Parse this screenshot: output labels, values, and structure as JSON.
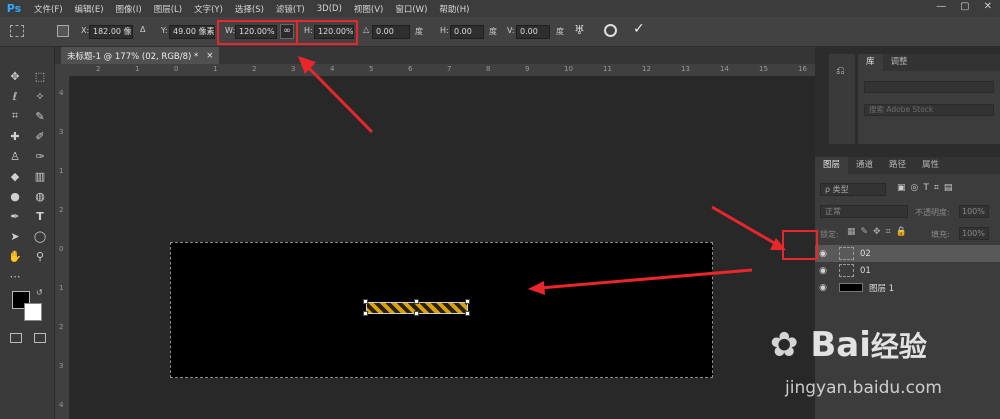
{
  "app": {
    "logo": "Ps"
  },
  "menu": [
    "文件(F)",
    "编辑(E)",
    "图像(I)",
    "图层(L)",
    "文字(Y)",
    "选择(S)",
    "滤镜(T)",
    "3D(D)",
    "视图(V)",
    "窗口(W)",
    "帮助(H)"
  ],
  "window_controls": [
    "—",
    "▢",
    "✕"
  ],
  "options": {
    "x_label": "X:",
    "x_value": "182.00 像素",
    "delta_icon": "Δ",
    "y_label": "Y:",
    "y_value": "49.00 像素",
    "w_label": "W:",
    "w_value": "120.00%",
    "link_icon": "link-icon",
    "h_label": "H:",
    "h_value": "120.00%",
    "angle_label": "△",
    "angle_value": "0.00",
    "angle_unit": "度",
    "hskew_label": "H:",
    "hskew_value": "0.00",
    "hskew_unit": "度",
    "vskew_label": "V:",
    "vskew_value": "0.00",
    "vskew_unit": "度",
    "cancel_symbol": "⃠",
    "commit_symbol": "✓"
  },
  "document": {
    "tab_title": "未标题-1 @ 177% (02, RGB/8) *",
    "close": "×"
  },
  "ruler": {
    "top": [
      "2",
      "1",
      "0",
      "1",
      "2",
      "3",
      "4",
      "5",
      "6",
      "7",
      "8",
      "9",
      "10",
      "11",
      "12",
      "13",
      "14",
      "15",
      "16"
    ],
    "left": [
      "4",
      "3",
      "1",
      "2",
      "0",
      "1",
      "2",
      "3",
      "4"
    ]
  },
  "library_panel": {
    "tabs": [
      "库",
      "调整"
    ],
    "search_placeholder": "搜索 Adobe Stock"
  },
  "layers_panel": {
    "tabs": [
      "图层",
      "通道",
      "路径",
      "属性"
    ],
    "filter_label": "ρ 类型",
    "blend_mode": "正常",
    "opacity_label": "不透明度:",
    "opacity_value": "100%",
    "lock_label": "锁定:",
    "fill_label": "填充:",
    "fill_value": "100%",
    "layers": [
      {
        "name": "02",
        "selected": true
      },
      {
        "name": "01",
        "selected": false
      },
      {
        "name": "图层 1",
        "selected": false
      }
    ]
  },
  "watermark": {
    "brand": "Bai",
    "brand2": "经验",
    "url": "jingyan.baidu.com"
  },
  "colors": {
    "accent": "#e8262b",
    "selection": "#595959",
    "ps_blue": "#31a8ff"
  }
}
